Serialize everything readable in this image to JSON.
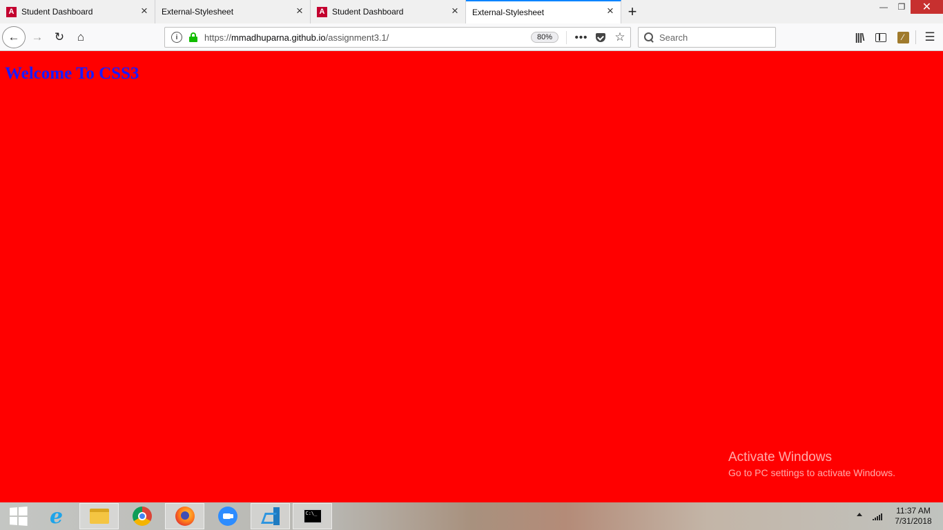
{
  "browser": {
    "tabs": [
      {
        "label": "Student Dashboard",
        "favicon": "angular-icon",
        "active": false
      },
      {
        "label": "External-Stylesheet",
        "favicon": null,
        "active": false
      },
      {
        "label": "Student Dashboard",
        "favicon": "angular-icon",
        "active": false
      },
      {
        "label": "External-Stylesheet",
        "favicon": null,
        "active": true
      }
    ],
    "favicon_letter": "A",
    "new_tab_symbol": "+",
    "url": {
      "scheme": "https://",
      "host": "mmadhuparna.github.io",
      "path": "/assignment3.1/"
    },
    "zoom": "80%",
    "search_placeholder": "Search",
    "accent_color": "#0a84ff"
  },
  "page": {
    "background_color": "#ff0000",
    "heading": "Welcome To CSS3",
    "heading_color": "#1a1aff"
  },
  "watermark": {
    "title": "Activate Windows",
    "subtitle": "Go to PC settings to activate Windows."
  },
  "taskbar": {
    "apps": [
      "windows-start-icon",
      "internet-explorer-icon",
      "file-explorer-icon",
      "chrome-icon",
      "firefox-icon",
      "zoom-icon",
      "vscode-icon",
      "command-prompt-icon"
    ],
    "active_app": "firefox-icon",
    "cmd_text": "C:\\_",
    "time": "11:37 AM",
    "date": "7/31/2018"
  }
}
